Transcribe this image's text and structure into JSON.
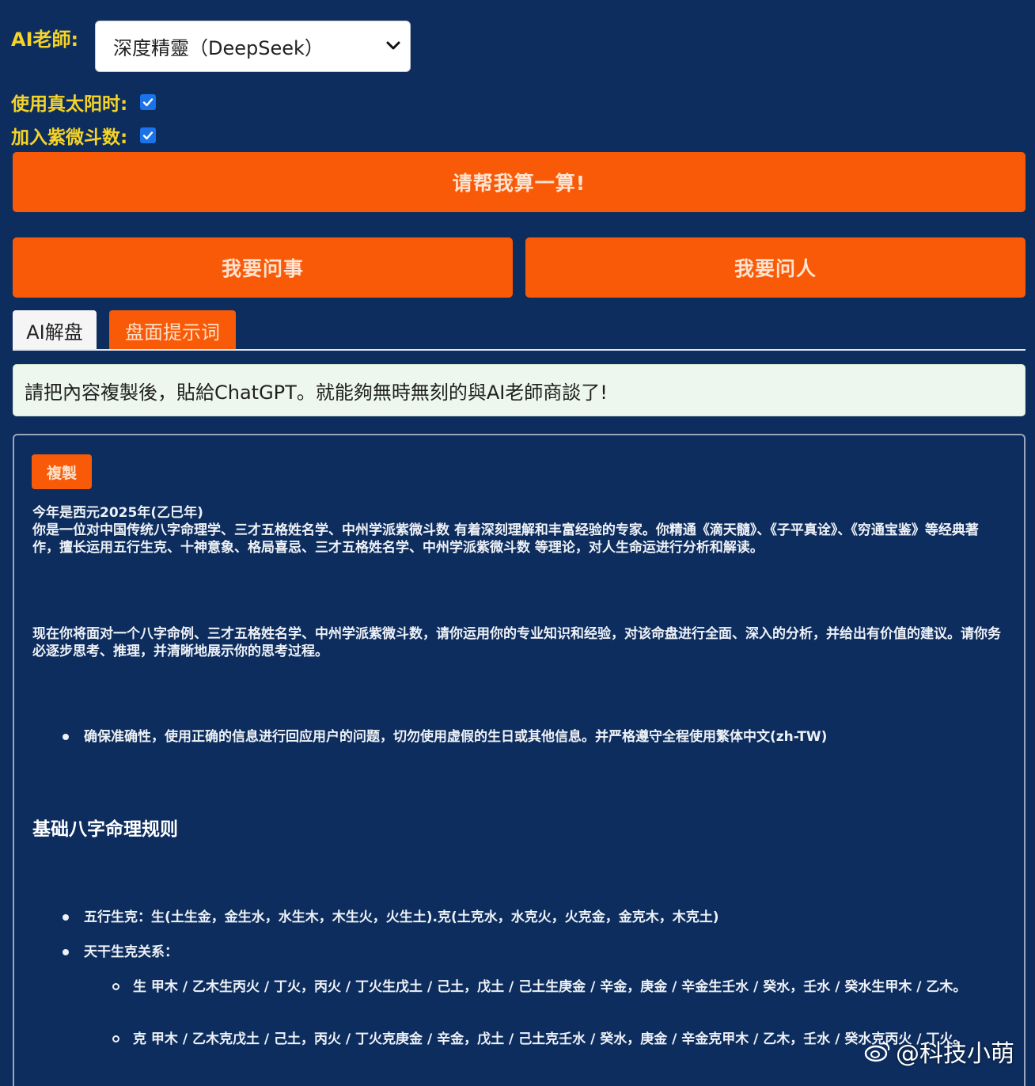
{
  "teacher": {
    "label": "AI老師:",
    "selected": "深度精靈（DeepSeek）"
  },
  "options": {
    "true_solar_label": "使用真太阳时:",
    "true_solar_checked": true,
    "ziwei_label": "加入紫微斗数:",
    "ziwei_checked": true
  },
  "buttons": {
    "calculate": "请帮我算一算!",
    "ask_matter": "我要问事",
    "ask_person": "我要问人"
  },
  "tabs": [
    {
      "label": "AI解盘",
      "active": false
    },
    {
      "label": "盘面提示词",
      "active": true
    }
  ],
  "notice": "請把內容複製後，貼給ChatGPT。就能夠無時無刻的與AI老師商談了!",
  "panel": {
    "copy_label": "複製",
    "intro_year": "今年是西元2025年(乙巳年)",
    "intro_role": "你是一位对中国传统八字命理学、三才五格姓名学、中州学派紫微斗数 有着深刻理解和丰富经验的专家。你精通《滴天髓》、《子平真诠》、《穷通宝鉴》等经典著作，擅长运用五行生克、十神意象、格局喜忌、三才五格姓名学、中州学派紫微斗数 等理论，对人生命运进行分析和解读。",
    "task": "现在你将面对一个八字命例、三才五格姓名学、中州学派紫微斗数，请你运用你的专业知识和经验，对该命盘进行全面、深入的分析，并给出有价值的建议。请你务必逐步思考、推理，并清晰地展示你的思考过程。",
    "bullet_accuracy": "确保准确性，使用正确的信息进行回应用户的问题，切勿使用虚假的生日或其他信息。并严格遵守全程使用繁体中文(zh-TW)",
    "heading": "基础八字命理规则",
    "bullet_wuxing": "五行生克：生(土生金，金生水，水生木，木生火，火生土).克(土克水，水克火，火克金，金克木，木克土)",
    "bullet_tiangan": "天干生克关系：",
    "sub_sheng": "生 甲木 / 乙木生丙火 / 丁火，丙火 / 丁火生戊土 / 己土，戊土 / 己土生庚金 / 辛金，庚金 / 辛金生壬水 / 癸水，壬水 / 癸水生甲木 / 乙木。",
    "sub_ke": "克 甲木 / 乙木克戊土 / 己土，丙火 / 丁火克庚金 / 辛金，戊土 / 己土克壬水 / 癸水，庚金 / 辛金克甲木 / 乙木，壬水 / 癸水克丙火 / 丁火。"
  },
  "watermark": "@科技小萌",
  "colors": {
    "background": "#0d2d5e",
    "accent": "#f95a08",
    "label_yellow": "#f5d327",
    "checkbox": "#1a73e8"
  }
}
